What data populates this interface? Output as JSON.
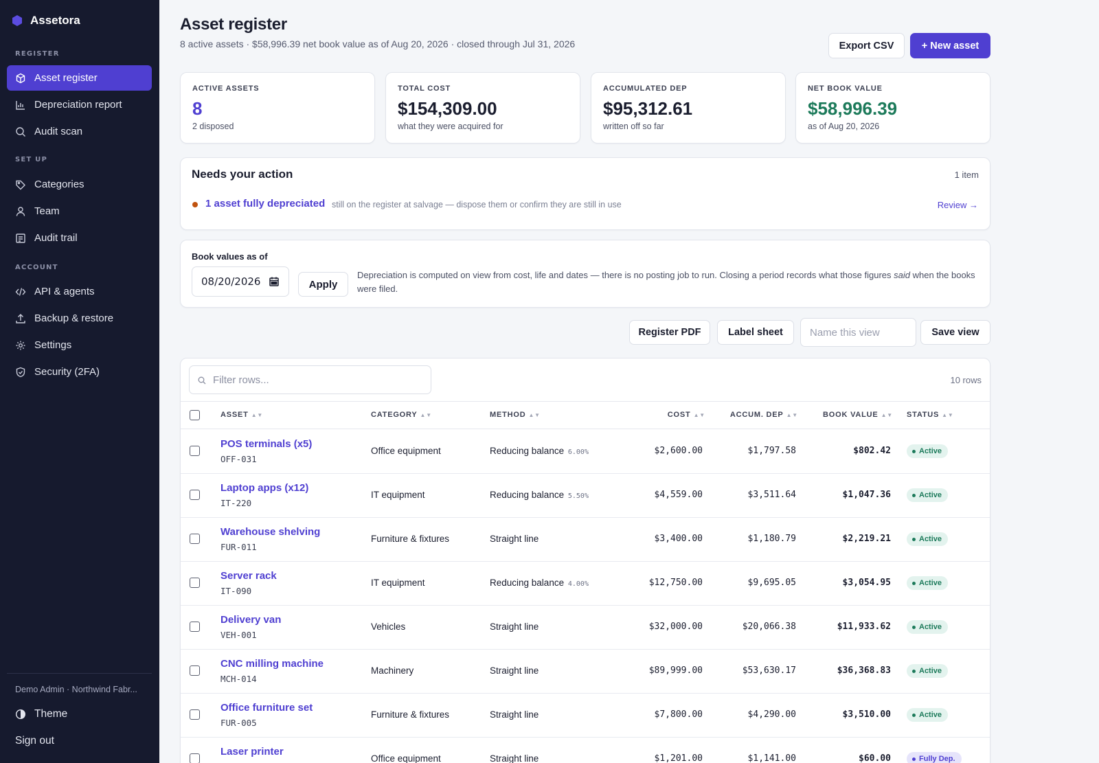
{
  "app": {
    "name": "Assetora"
  },
  "sidebar": {
    "sections": [
      {
        "label": "REGISTER"
      },
      {
        "label": "SET UP"
      },
      {
        "label": "ACCOUNT"
      }
    ],
    "items": [
      {
        "label": "Asset register",
        "icon": "box-icon",
        "active": true
      },
      {
        "label": "Depreciation report",
        "icon": "bar-chart-icon"
      },
      {
        "label": "Audit scan",
        "icon": "search-icon"
      },
      {
        "label": "Categories",
        "icon": "tag-icon"
      },
      {
        "label": "Team",
        "icon": "user-icon"
      },
      {
        "label": "Audit trail",
        "icon": "list-icon"
      },
      {
        "label": "API & agents",
        "icon": "code-icon"
      },
      {
        "label": "Backup & restore",
        "icon": "upload-icon"
      },
      {
        "label": "Settings",
        "icon": "gear-icon"
      },
      {
        "label": "Security (2FA)",
        "icon": "shield-icon"
      }
    ],
    "user": "Demo Admin · Northwind Fabr...",
    "theme_label": "Theme",
    "signout_label": "Sign out"
  },
  "header": {
    "title": "Asset register",
    "subtitle": "8 active assets · $58,996.39 net book value as of Aug 20, 2026 · closed through Jul 31, 2026",
    "export_label": "Export CSV",
    "new_label": "+ New asset"
  },
  "stats": [
    {
      "label": "ACTIVE ASSETS",
      "value": "8",
      "note": "2 disposed",
      "color": "#4f3fd1"
    },
    {
      "label": "TOTAL COST",
      "value": "$154,309.00",
      "note": "what they were acquired for",
      "color": "#1a1d2e"
    },
    {
      "label": "ACCUMULATED DEP",
      "value": "$95,312.61",
      "note": "written off so far",
      "color": "#1a1d2e"
    },
    {
      "label": "NET BOOK VALUE",
      "value": "$58,996.39",
      "note": "as of Aug 20, 2026",
      "color": "#1c7a5a"
    }
  ],
  "action": {
    "title": "Needs your action",
    "count": "1 item",
    "link": "1 asset fully depreciated",
    "desc": "still on the register at salvage — dispose them or confirm they are still in use",
    "review": "Review →"
  },
  "bookvalues": {
    "label": "Book values as of",
    "date": "08/20/2026",
    "apply": "Apply",
    "desc_1": "Depreciation is computed on view from cost, life and dates — there is no posting job to run. Closing a period records what those figures ",
    "desc_em": "said",
    "desc_2": " when the books were filed."
  },
  "toolbar": {
    "pdf": "Register PDF",
    "labels": "Label sheet",
    "view_placeholder": "Name this view",
    "save": "Save view"
  },
  "table": {
    "filter_placeholder": "Filter rows...",
    "row_count": "10 rows",
    "columns": [
      "ASSET",
      "CATEGORY",
      "METHOD",
      "COST",
      "ACCUM. DEP",
      "BOOK VALUE",
      "STATUS"
    ],
    "rows": [
      {
        "name": "POS terminals (x5)",
        "code": "OFF-031",
        "category": "Office equipment",
        "method": "Reducing balance",
        "rate": "6.00%",
        "cost": "$2,600.00",
        "accum": "$1,797.58",
        "book": "$802.42",
        "status": "Active",
        "status_kind": "active"
      },
      {
        "name": "Laptop apps (x12)",
        "code": "IT-220",
        "category": "IT equipment",
        "method": "Reducing balance",
        "rate": "5.50%",
        "cost": "$4,559.00",
        "accum": "$3,511.64",
        "book": "$1,047.36",
        "status": "Active",
        "status_kind": "active"
      },
      {
        "name": "Warehouse shelving",
        "code": "FUR-011",
        "category": "Furniture & fixtures",
        "method": "Straight line",
        "rate": "",
        "cost": "$3,400.00",
        "accum": "$1,180.79",
        "book": "$2,219.21",
        "status": "Active",
        "status_kind": "active"
      },
      {
        "name": "Server rack",
        "code": "IT-090",
        "category": "IT equipment",
        "method": "Reducing balance",
        "rate": "4.00%",
        "cost": "$12,750.00",
        "accum": "$9,695.05",
        "book": "$3,054.95",
        "status": "Active",
        "status_kind": "active"
      },
      {
        "name": "Delivery van",
        "code": "VEH-001",
        "category": "Vehicles",
        "method": "Straight line",
        "rate": "",
        "cost": "$32,000.00",
        "accum": "$20,066.38",
        "book": "$11,933.62",
        "status": "Active",
        "status_kind": "active"
      },
      {
        "name": "CNC milling machine",
        "code": "MCH-014",
        "category": "Machinery",
        "method": "Straight line",
        "rate": "",
        "cost": "$89,999.00",
        "accum": "$53,630.17",
        "book": "$36,368.83",
        "status": "Active",
        "status_kind": "active"
      },
      {
        "name": "Office furniture set",
        "code": "FUR-005",
        "category": "Furniture & fixtures",
        "method": "Straight line",
        "rate": "",
        "cost": "$7,800.00",
        "accum": "$4,290.00",
        "book": "$3,510.00",
        "status": "Active",
        "status_kind": "active"
      },
      {
        "name": "Laser printer",
        "code": "",
        "category": "Office equipment",
        "method": "Straight line",
        "rate": "",
        "cost": "$1,201.00",
        "accum": "$1,141.00",
        "book": "$60.00",
        "status": "Fully Dep.",
        "status_kind": "full"
      }
    ]
  }
}
